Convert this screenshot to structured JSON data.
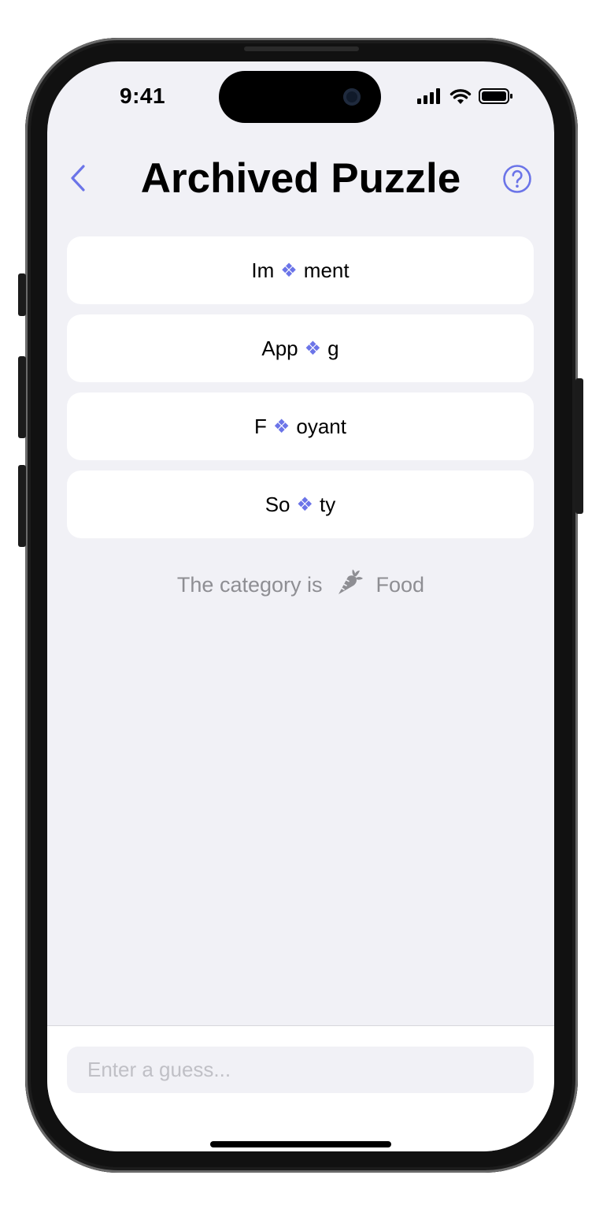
{
  "status_bar": {
    "time": "9:41"
  },
  "nav": {
    "title": "Archived Puzzle",
    "back_icon": "chevron-left-icon",
    "help_icon": "question-circle-icon"
  },
  "accent_color": "#6b74e8",
  "clues": [
    {
      "prefix": "Im",
      "hidden": "❖",
      "suffix": "ment"
    },
    {
      "prefix": "App",
      "hidden": "❖",
      "suffix": "g"
    },
    {
      "prefix": "F",
      "hidden": "❖",
      "suffix": "oyant"
    },
    {
      "prefix": "So",
      "hidden": "❖",
      "suffix": "ty"
    }
  ],
  "category": {
    "label": "The category is",
    "icon": "carrot-icon",
    "value": "Food"
  },
  "guess": {
    "placeholder": "Enter a guess...",
    "value": ""
  }
}
